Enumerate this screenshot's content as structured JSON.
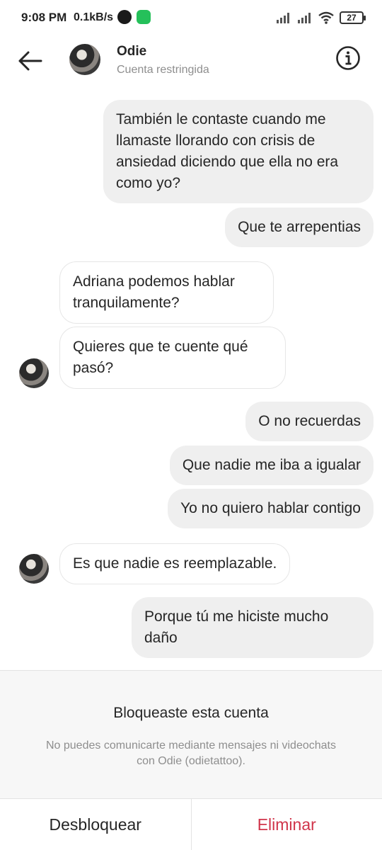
{
  "status_bar": {
    "time": "9:08 PM",
    "speed": "0.1kB/s",
    "battery": "27"
  },
  "header": {
    "name": "Odie",
    "status": "Cuenta restringida"
  },
  "messages": [
    {
      "direction": "out",
      "text": "También le contaste cuando me llamaste llorando con crisis de ansiedad diciendo que ella no era como yo?"
    },
    {
      "direction": "out",
      "text": "Que te arrepentias"
    },
    {
      "direction": "in",
      "text": "Adriana podemos hablar tranquilamente?"
    },
    {
      "direction": "in",
      "text": "Quieres que te cuente qué pasó?"
    },
    {
      "direction": "out",
      "text": "O no recuerdas"
    },
    {
      "direction": "out",
      "text": "Que nadie me iba a igualar"
    },
    {
      "direction": "out",
      "text": "Yo no quiero hablar contigo"
    },
    {
      "direction": "in",
      "text": "Es que nadie es reemplazable."
    },
    {
      "direction": "out",
      "text": "Porque tú me hiciste mucho daño"
    }
  ],
  "blocked": {
    "title": "Bloqueaste esta cuenta",
    "description": "No puedes comunicarte mediante mensajes ni videochats con Odie (odietattoo)."
  },
  "actions": {
    "unblock": "Desbloquear",
    "delete": "Eliminar"
  },
  "colors": {
    "outgoing_bubble": "#efefef",
    "incoming_border": "#e6e6e6",
    "delete_red": "#d0344a",
    "secondary_text": "#8e8e8e"
  }
}
